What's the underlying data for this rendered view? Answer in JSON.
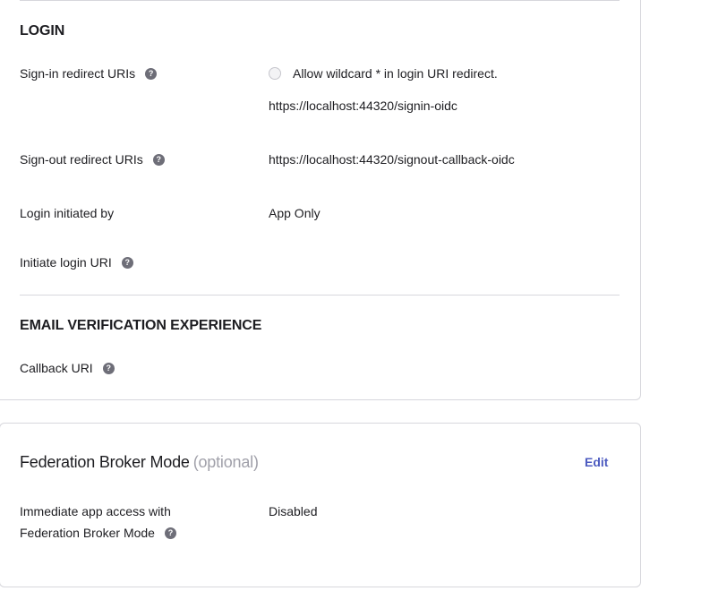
{
  "login_section": {
    "title": "LOGIN",
    "sign_in": {
      "label": "Sign-in redirect URIs",
      "wildcard_label": "Allow wildcard * in login URI redirect.",
      "wildcard_checked": false,
      "uri": "https://localhost:44320/signin-oidc"
    },
    "sign_out": {
      "label": "Sign-out redirect URIs",
      "uri": "https://localhost:44320/signout-callback-oidc"
    },
    "login_initiated": {
      "label": "Login initiated by",
      "value": "App Only"
    },
    "initiate_login_uri": {
      "label": "Initiate login URI"
    }
  },
  "email_section": {
    "title": "EMAIL VERIFICATION EXPERIENCE",
    "callback": {
      "label": "Callback URI"
    }
  },
  "federation": {
    "title": "Federation Broker Mode",
    "optional": "(optional)",
    "edit_label": "Edit",
    "immediate_access": {
      "label_line1": "Immediate app access with",
      "label_line2": "Federation Broker Mode",
      "value": "Disabled"
    }
  },
  "help_glyph": "?",
  "colors": {
    "link": "#4d5bc0",
    "muted": "#a1a1aa",
    "border": "#d7d7dc"
  }
}
